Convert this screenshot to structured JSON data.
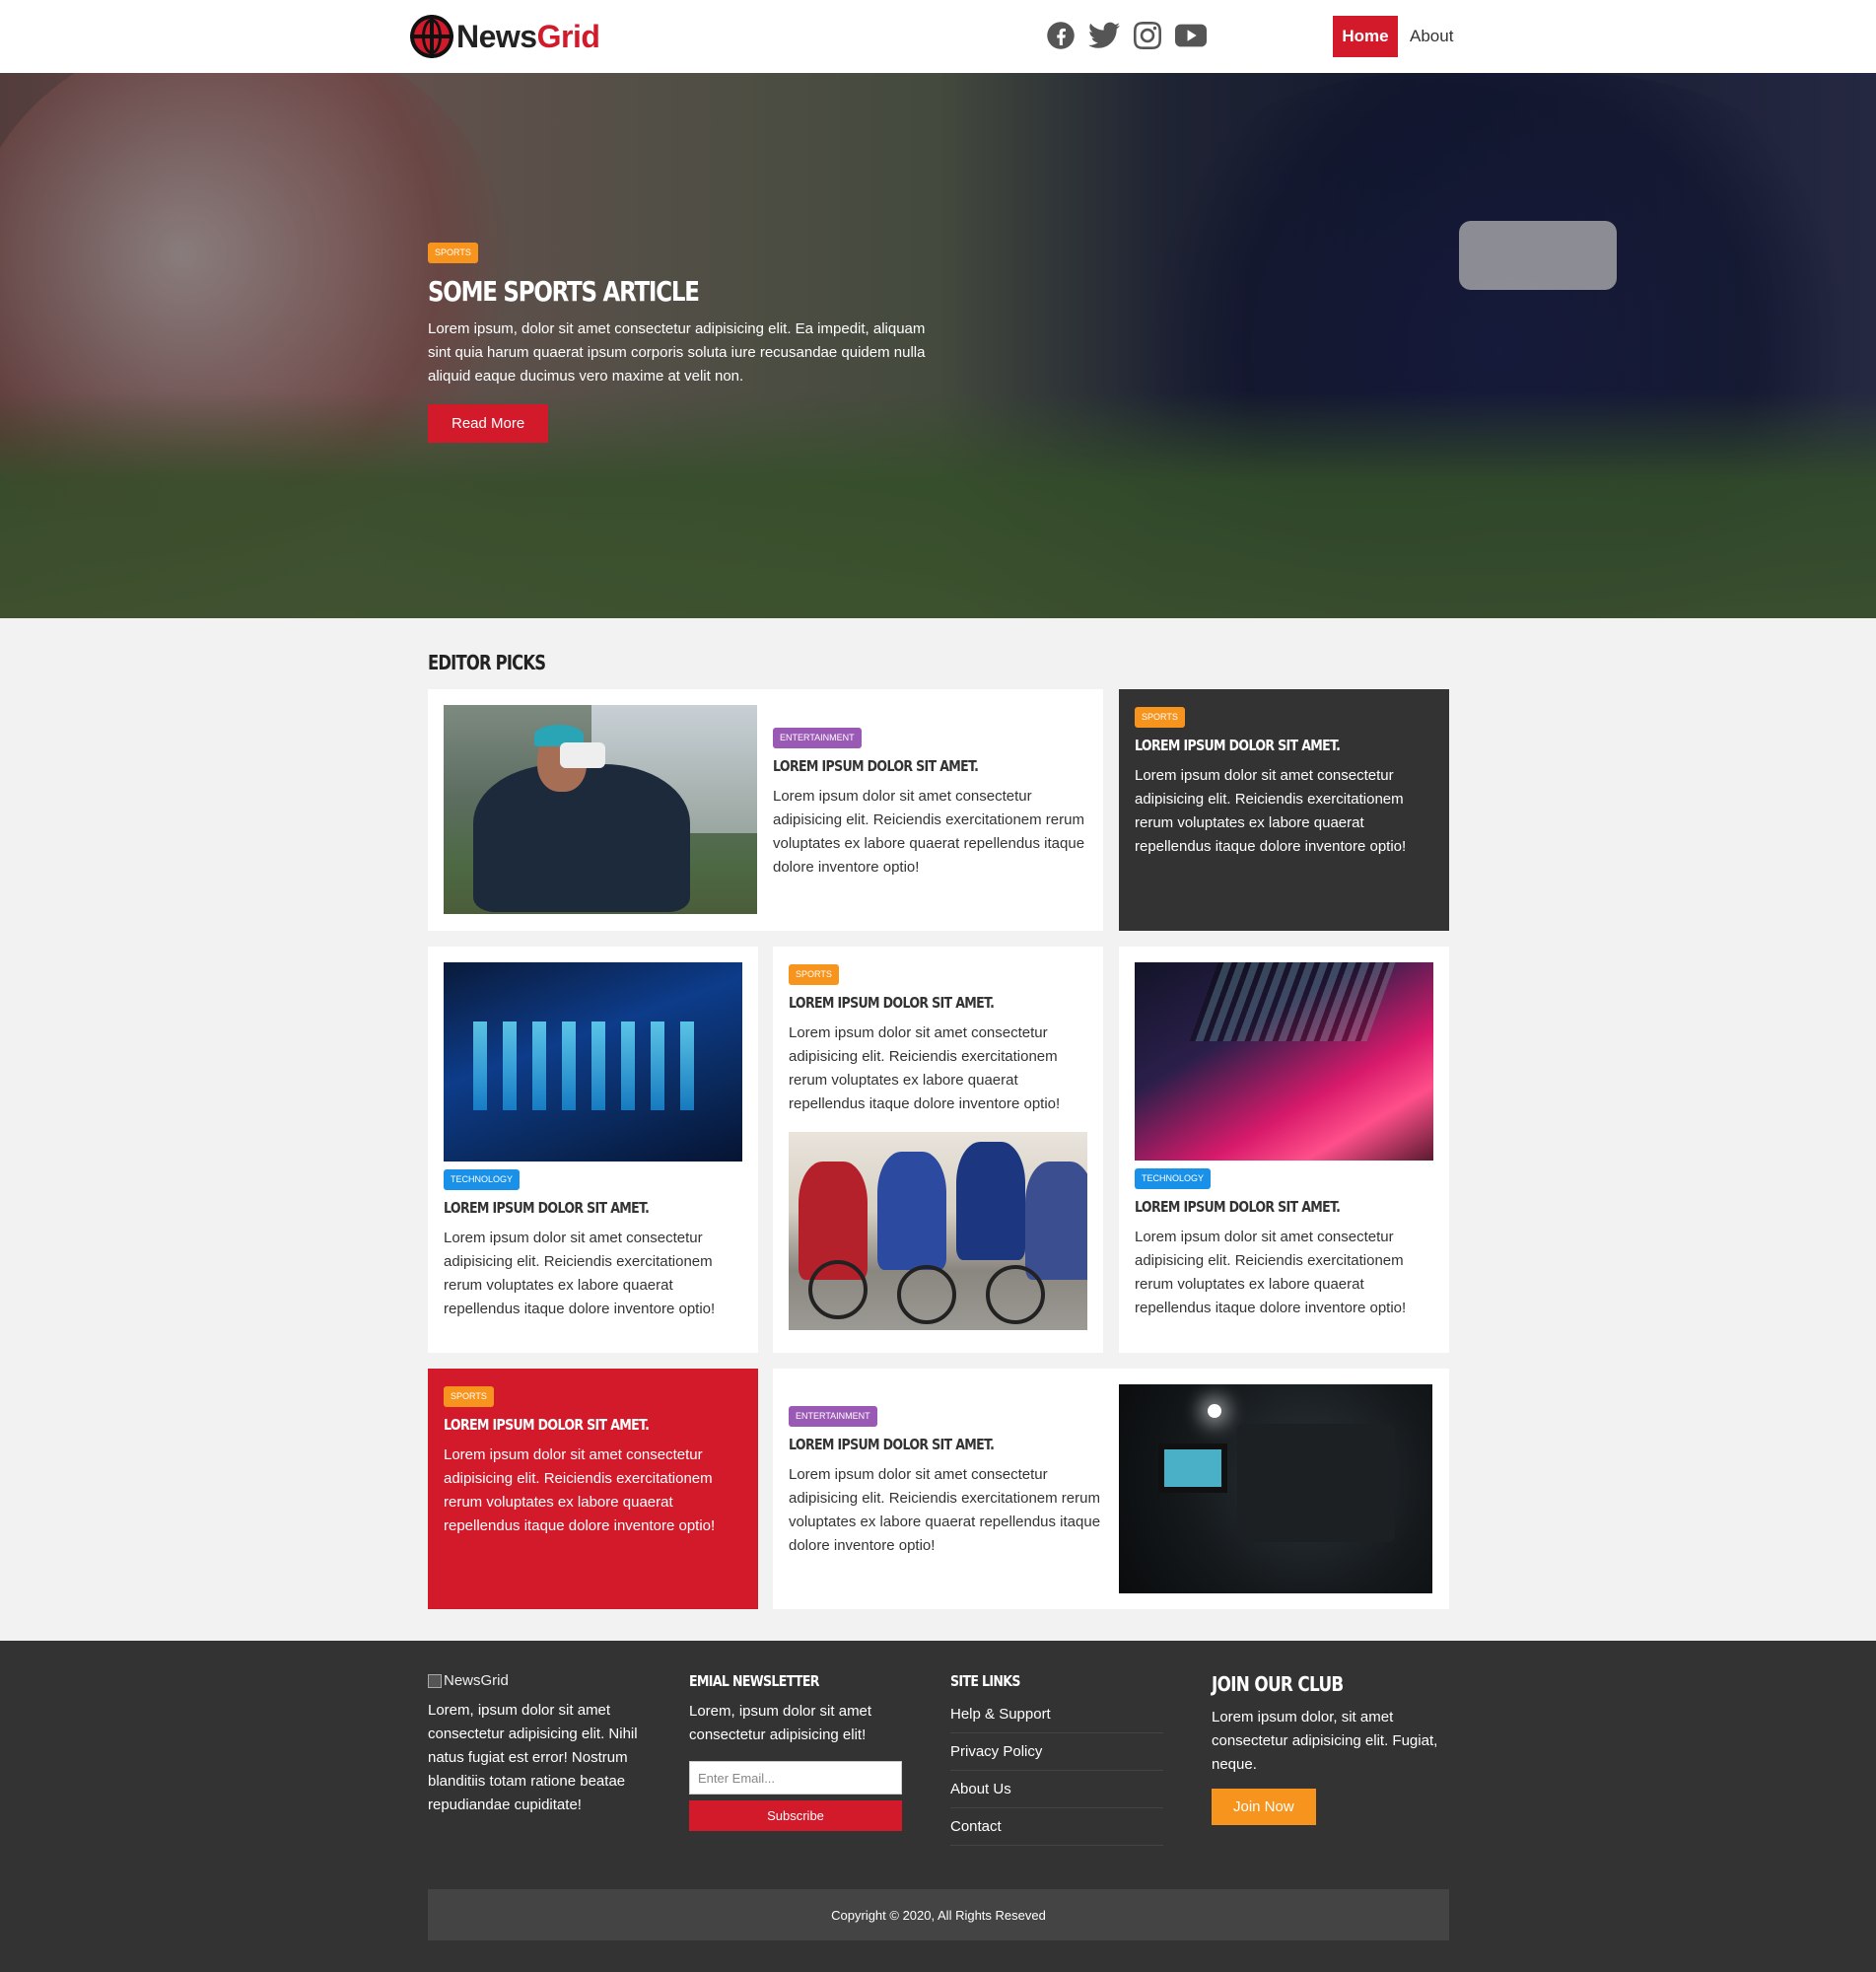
{
  "header": {
    "logo_part1": "News",
    "logo_part2": "Grid",
    "socials": [
      "facebook-icon",
      "twitter-icon",
      "instagram-icon",
      "youtube-icon"
    ],
    "nav": {
      "home": "Home",
      "about": "About"
    }
  },
  "hero": {
    "tag": "SPORTS",
    "title": "SOME SPORTS ARTICLE",
    "text": "Lorem ipsum, dolor sit amet consectetur adipisicing elit. Ea impedit, aliquam sint quia harum quaerat ipsum corporis soluta iure recusandae quidem nulla aliquid eaque ducimus vero maxime at velit non.",
    "button": "Read More"
  },
  "editor_picks": {
    "title": "EDITOR PICKS",
    "cards": [
      {
        "tag": "ENTERTAINMENT",
        "title": "LOREM IPSUM DOLOR SIT AMET.",
        "text": "Lorem ipsum dolor sit amet consectetur adipisicing elit. Reiciendis exercitationem rerum voluptates ex labore quaerat repellendus itaque dolore inventore optio!"
      },
      {
        "tag": "SPORTS",
        "title": "LOREM IPSUM DOLOR SIT AMET.",
        "text": "Lorem ipsum dolor sit amet consectetur adipisicing elit. Reiciendis exercitationem rerum voluptates ex labore quaerat repellendus itaque dolore inventore optio!"
      },
      {
        "tag": "TECHNOLOGY",
        "title": "LOREM IPSUM DOLOR SIT AMET.",
        "text": "Lorem ipsum dolor sit amet consectetur adipisicing elit. Reiciendis exercitationem rerum voluptates ex labore quaerat repellendus itaque dolore inventore optio!"
      },
      {
        "tag": "SPORTS",
        "title": "LOREM IPSUM DOLOR SIT AMET.",
        "text": "Lorem ipsum dolor sit amet consectetur adipisicing elit. Reiciendis exercitationem rerum voluptates ex labore quaerat repellendus itaque dolore inventore optio!"
      },
      {
        "tag": "TECHNOLOGY",
        "title": "LOREM IPSUM DOLOR SIT AMET.",
        "text": "Lorem ipsum dolor sit amet consectetur adipisicing elit. Reiciendis exercitationem rerum voluptates ex labore quaerat repellendus itaque dolore inventore optio!"
      },
      {
        "tag": "SPORTS",
        "title": "LOREM IPSUM DOLOR SIT AMET.",
        "text": "Lorem ipsum dolor sit amet consectetur adipisicing elit. Reiciendis exercitationem rerum voluptates ex labore quaerat repellendus itaque dolore inventore optio!"
      },
      {
        "tag": "ENTERTAINMENT",
        "title": "LOREM IPSUM DOLOR SIT AMET.",
        "text": "Lorem ipsum dolor sit amet consectetur adipisicing elit. Reiciendis exercitationem rerum voluptates ex labore quaerat repellendus itaque dolore inventore optio!"
      }
    ]
  },
  "footer": {
    "brand_alt": "NewsGrid",
    "about_text": "Lorem, ipsum dolor sit amet consectetur adipisicing elit. Nihil natus fugiat est error! Nostrum blanditiis totam ratione beatae repudiandae cupiditate!",
    "newsletter_title": "EMIAL NEWSLETTER",
    "newsletter_text": "Lorem, ipsum dolor sit amet consectetur adipisicing elit!",
    "email_placeholder": "Enter Email...",
    "subscribe": "Subscribe",
    "links_title": "SITE LINKS",
    "links": [
      "Help & Support",
      "Privacy Policy",
      "About Us",
      "Contact"
    ],
    "club_title": "JOIN OUR CLUB",
    "club_text": "Lorem ipsum dolor, sit amet consectetur adipisicing elit. Fugiat, neque.",
    "join": "Join Now",
    "copyright": "Copyright © 2020, All Rights Reseved"
  },
  "colors": {
    "brand_red": "#d21a2b",
    "sports": "#f7941d",
    "entertainment": "#9b59b6",
    "technology": "#1a91e8",
    "dark": "#333333"
  }
}
